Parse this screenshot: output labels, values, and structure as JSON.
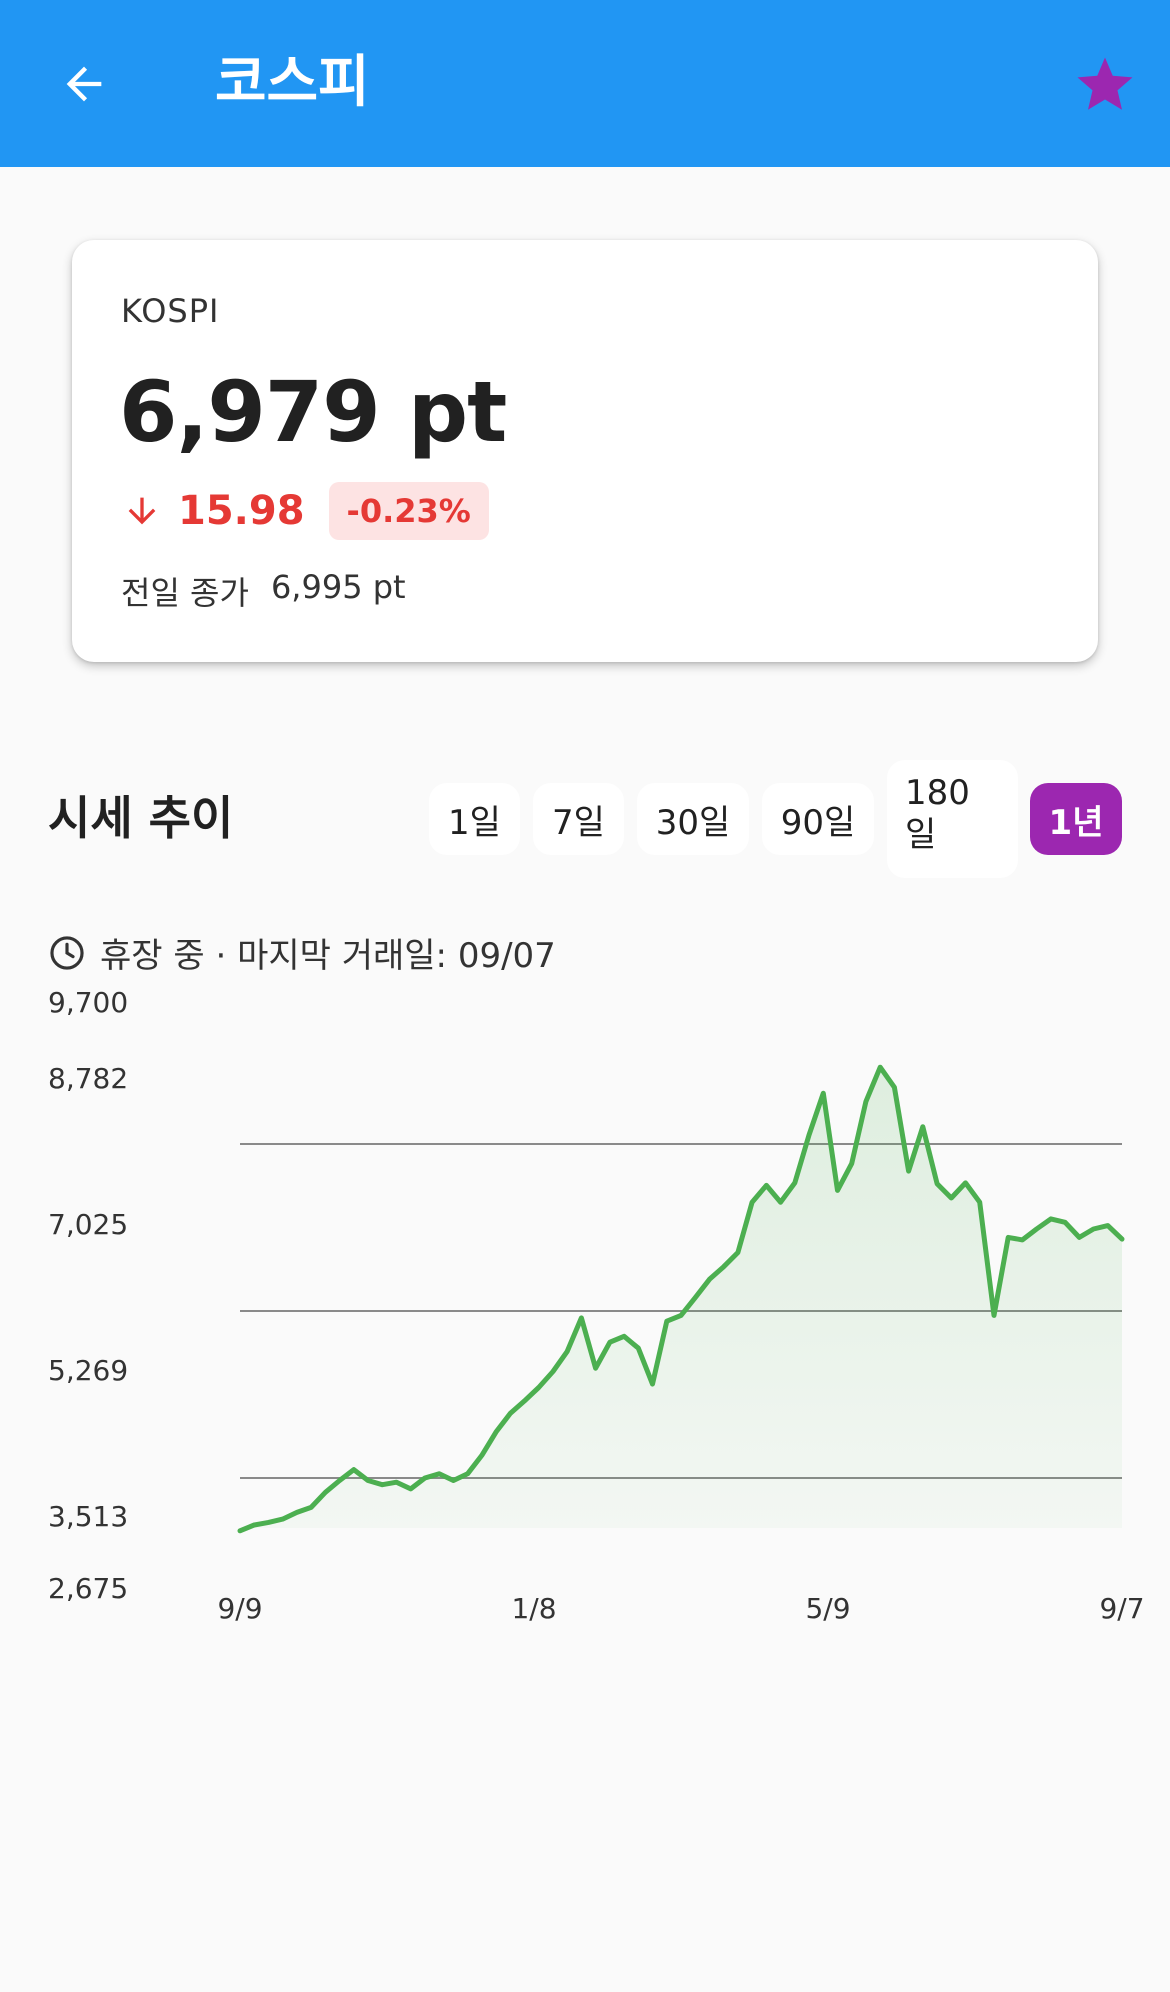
{
  "appbar": {
    "title": "코스피",
    "back_icon": "arrow-left-icon",
    "favorite_icon": "star-icon",
    "background": "#2196f3",
    "favorite_color": "#9c27b0"
  },
  "quote": {
    "symbol": "KOSPI",
    "price": "6,979 pt",
    "change": "15.98",
    "change_percent": "-0.23%",
    "direction_icon": "arrow-down-icon",
    "prev_close_label": "전일 종가",
    "prev_close_value": "6,995 pt",
    "down_color": "#e53935"
  },
  "trend": {
    "title": "시세 추이",
    "ranges": [
      {
        "label": "1일",
        "selected": false
      },
      {
        "label": "7일",
        "selected": false
      },
      {
        "label": "30일",
        "selected": false
      },
      {
        "label": "90일",
        "selected": false
      },
      {
        "label": "180\n일",
        "selected": false
      },
      {
        "label": "1년",
        "selected": true
      }
    ],
    "status": "휴장 중 · 마지막 거래일: 09/07",
    "status_icon": "clock-icon"
  },
  "chart_data": {
    "type": "area",
    "y_tick_labels": [
      "9,700",
      "8,782",
      "7,025",
      "5,269",
      "3,513",
      "2,675"
    ],
    "x_tick_labels": [
      "9/9",
      "1/8",
      "5/9",
      "9/7"
    ],
    "ylim": [
      2675,
      9700
    ],
    "line_color": "#4caf50",
    "series": [
      {
        "values": [
          3500,
          3570,
          3600,
          3640,
          3720,
          3780,
          3960,
          4100,
          4230,
          4100,
          4050,
          4080,
          4000,
          4130,
          4180,
          4100,
          4180,
          4400,
          4680,
          4900,
          5050,
          5210,
          5400,
          5640,
          6040,
          5440,
          5750,
          5820,
          5680,
          5250,
          6000,
          6070,
          6280,
          6500,
          6650,
          6820,
          7420,
          7620,
          7420,
          7650,
          8220,
          8720,
          7560,
          7880,
          8620,
          9030,
          8790,
          7790,
          8320,
          7640,
          7470,
          7650,
          7420,
          6070,
          7000,
          6970,
          7100,
          7220,
          7180,
          7000,
          7100,
          7140,
          6980
        ]
      }
    ]
  }
}
